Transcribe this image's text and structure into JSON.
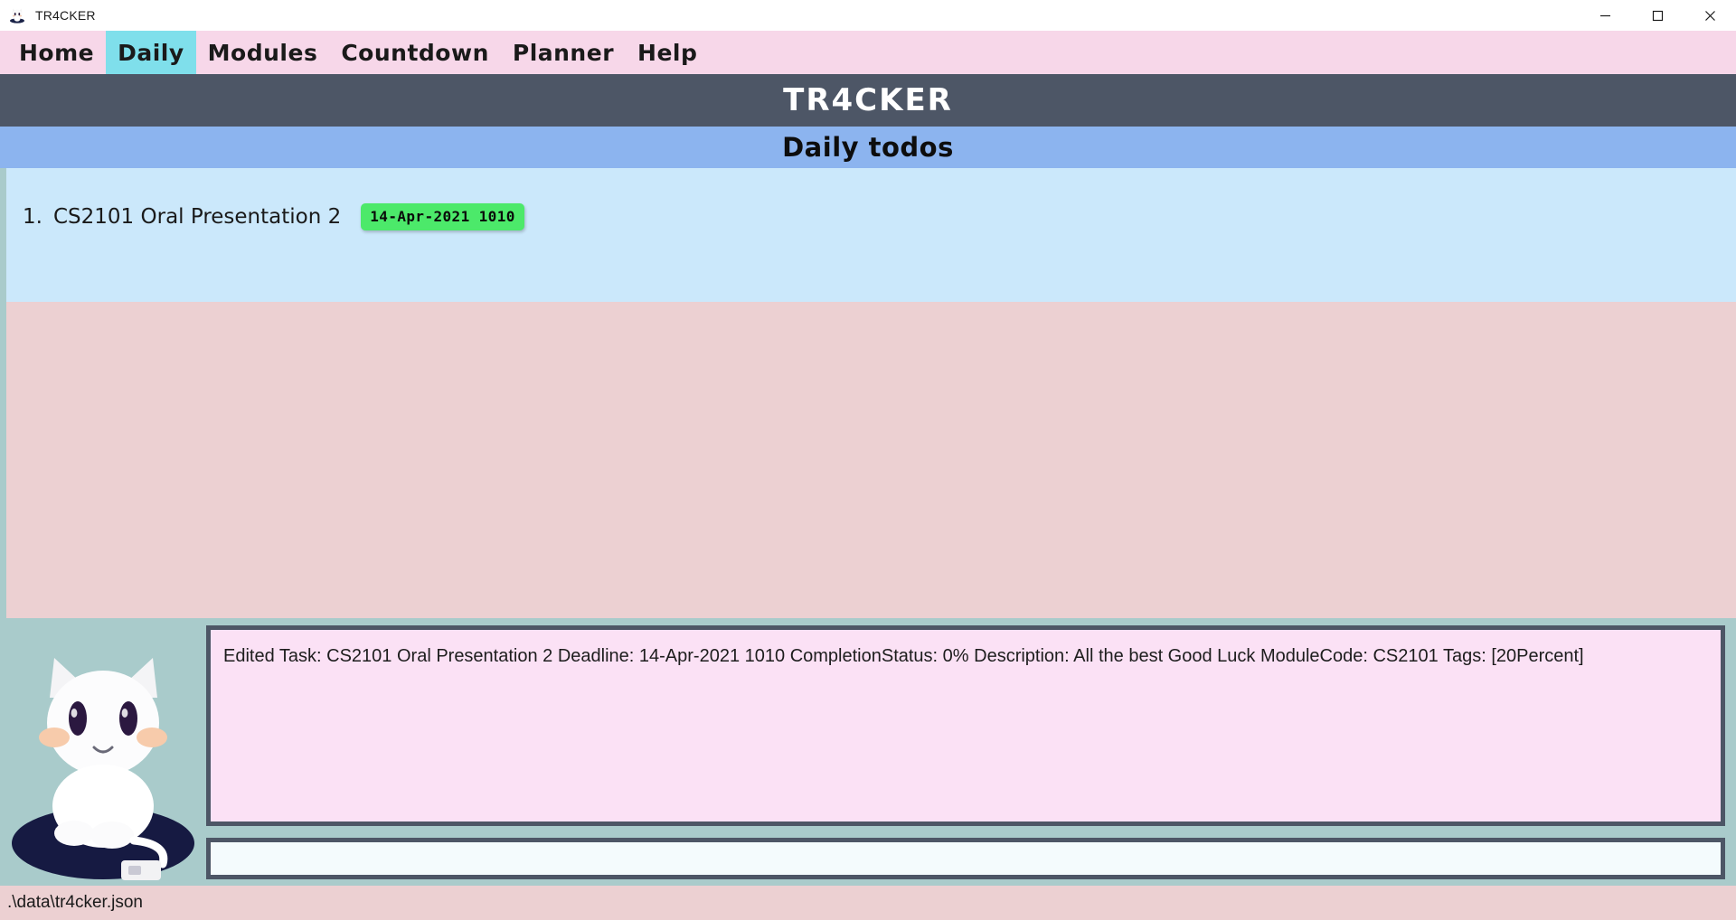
{
  "window": {
    "title": "TR4CKER",
    "icon": "cat-mascot-icon",
    "controls": {
      "minimize": "minimize-icon",
      "maximize": "maximize-icon",
      "close": "close-icon"
    }
  },
  "menubar": {
    "items": [
      {
        "label": "Home",
        "selected": false
      },
      {
        "label": "Daily",
        "selected": true
      },
      {
        "label": "Modules",
        "selected": false
      },
      {
        "label": "Countdown",
        "selected": false
      },
      {
        "label": "Planner",
        "selected": false
      },
      {
        "label": "Help",
        "selected": false
      }
    ],
    "background_color": "#f7d7e9",
    "selected_color": "#7fdfeb"
  },
  "header": {
    "title": "TR4CKER",
    "background_color": "#4d5666",
    "text_color": "#ffffff"
  },
  "section": {
    "title": "Daily todos",
    "background_color": "#8cb4ef"
  },
  "task_list": {
    "background_color": "#cbe8fb",
    "tasks": [
      {
        "index": "1.",
        "title": "CS2101 Oral Presentation 2",
        "deadline": "14-Apr-2021 1010",
        "deadline_badge_color": "#4ce96a"
      }
    ]
  },
  "result_display": {
    "text": "Edited Task: CS2101 Oral Presentation 2 Deadline: 14-Apr-2021 1010 CompletionStatus: 0% Description: All the best Good Luck ModuleCode: CS2101 Tags: [20Percent]",
    "background_color": "#fbe1f5",
    "border_color": "#4d5666"
  },
  "command_box": {
    "value": "",
    "placeholder": "",
    "background_color": "#f4fbfd"
  },
  "mascot": {
    "name": "cat-mascot",
    "background_color": "#a9cbcb"
  },
  "statusbar": {
    "path": ".\\data\\tr4cker.json",
    "background_color": "#ecd0d2"
  }
}
